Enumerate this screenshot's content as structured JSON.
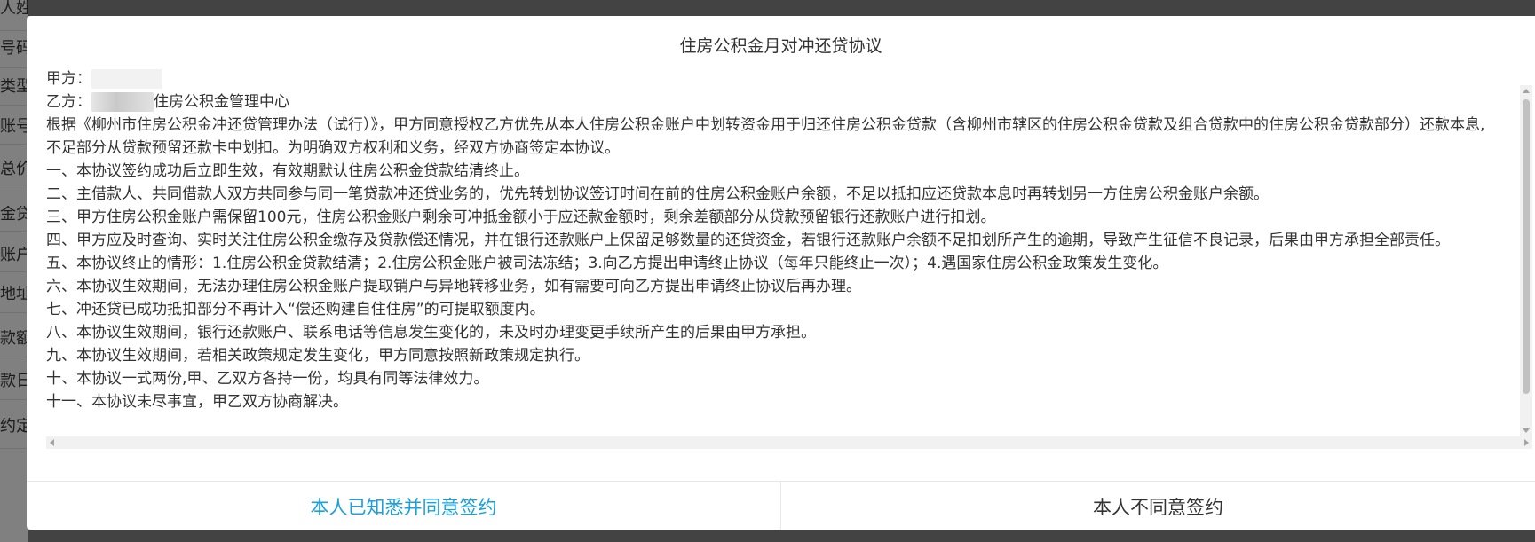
{
  "background": {
    "labels": [
      "人姓名",
      "号码",
      "类型",
      "账号",
      "总价",
      "金贷",
      "账户",
      "地址",
      "款额",
      "款日",
      "约定"
    ]
  },
  "modal": {
    "title": "住房公积金月对冲还贷协议",
    "party_a_label": "甲方：",
    "party_b_label": "乙方：",
    "party_b_suffix": "住房公积金管理中心",
    "paragraphs": [
      "根据《柳州市住房公积金冲还贷管理办法（试行）》，甲方同意授权乙方优先从本人住房公积金账户中划转资金用于归还住房公积金贷款（含柳州市辖区的住房公积金贷款及组合贷款中的住房公积金贷款部分）还款本息,不足部分从贷款预留还款卡中划扣。为明确双方权利和义务，经双方协商签定本协议。",
      "一、本协议签约成功后立即生效，有效期默认住房公积金贷款结清终止。",
      "二、主借款人、共同借款人双方共同参与同一笔贷款冲还贷业务的，优先转划协议签订时间在前的住房公积金账户余额，不足以抵扣应还贷款本息时再转划另一方住房公积金账户余额。",
      "三、甲方住房公积金账户需保留100元，住房公积金账户剩余可冲抵金额小于应还款金额时，剩余差额部分从贷款预留银行还款账户进行扣划。",
      "四、甲方应及时查询、实时关注住房公积金缴存及贷款偿还情况，并在银行还款账户上保留足够数量的还贷资金，若银行还款账户余额不足扣划所产生的逾期，导致产生征信不良记录，后果由甲方承担全部责任。",
      "五、本协议终止的情形：1.住房公积金贷款结清；2.住房公积金账户被司法冻结；3.向乙方提出申请终止协议（每年只能终止一次）；4.遇国家住房公积金政策发生变化。",
      "六、本协议生效期间，无法办理住房公积金账户提取销户与异地转移业务，如有需要可向乙方提出申请终止协议后再办理。",
      "七、冲还贷已成功抵扣部分不再计入“偿还购建自住住房”的可提取额度内。",
      "八、本协议生效期间，银行还款账户、联系电话等信息发生变化的，未及时办理变更手续所产生的后果由甲方承担。",
      "九、本协议生效期间，若相关政策规定发生变化，甲方同意按照新政策规定执行。",
      "十、本协议一式两份,甲、乙双方各持一份，均具有同等法律效力。",
      "十一、本协议未尽事宜，甲乙双方协商解决。"
    ],
    "agree_label": "本人已知悉并同意签约",
    "disagree_label": "本人不同意签约",
    "accent_color": "#1aa0dc"
  }
}
